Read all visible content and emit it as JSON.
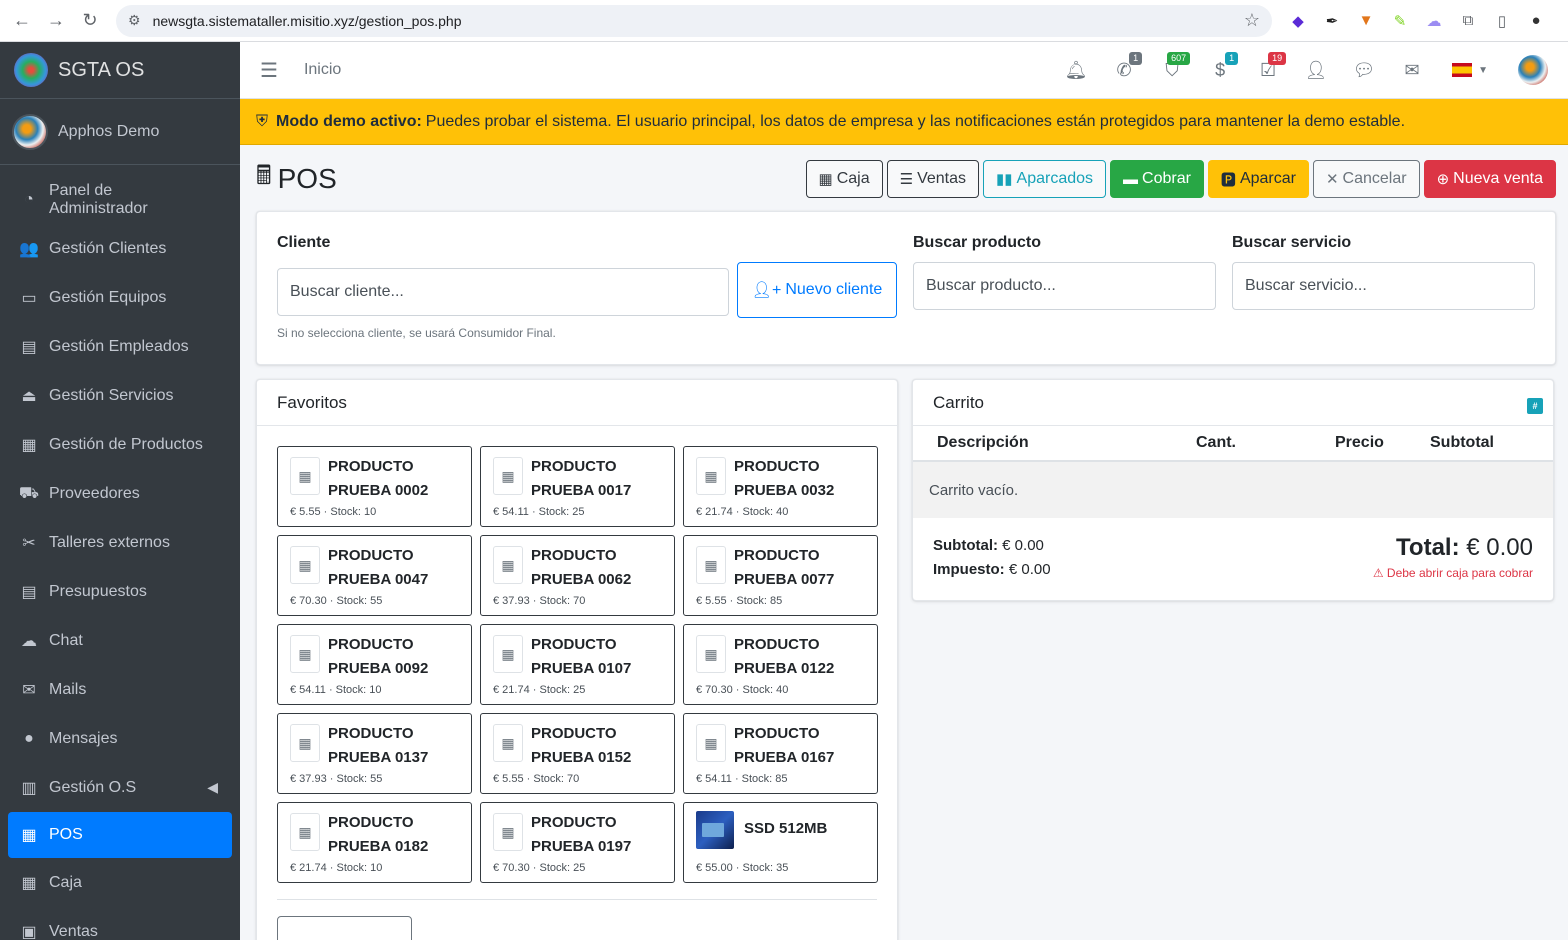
{
  "browser": {
    "url": "newsgta.sistemataller.misitio.xyz/gestion_pos.php"
  },
  "brand": {
    "name": "SGTA OS"
  },
  "user": {
    "name": "Apphos Demo"
  },
  "sidebar": {
    "items": [
      {
        "label": "Panel de Administrador",
        "icon": "dashboard-icon",
        "glyph": "◔"
      },
      {
        "label": "Gestión Clientes",
        "icon": "users-icon",
        "glyph": "👥"
      },
      {
        "label": "Gestión Equipos",
        "icon": "laptop-icon",
        "glyph": "💻"
      },
      {
        "label": "Gestión Empleados",
        "icon": "id-card-icon",
        "glyph": "🪪"
      },
      {
        "label": "Gestión Servicios",
        "icon": "concierge-bell-icon",
        "glyph": "🛎"
      },
      {
        "label": "Gestión de Productos",
        "icon": "box-icon",
        "glyph": "📦"
      },
      {
        "label": "Proveedores",
        "icon": "truck-icon",
        "glyph": "🚚"
      },
      {
        "label": "Talleres externos",
        "icon": "tools-icon",
        "glyph": "🛠"
      },
      {
        "label": "Presupuestos",
        "icon": "invoice-icon",
        "glyph": "📄"
      },
      {
        "label": "Chat",
        "icon": "chat-icon",
        "glyph": "💬"
      },
      {
        "label": "Mails",
        "icon": "envelope-icon",
        "glyph": "✉"
      },
      {
        "label": "Mensajes",
        "icon": "comment-dots-icon",
        "glyph": "🗨"
      },
      {
        "label": "Gestión O.S",
        "icon": "clipboard-icon",
        "glyph": "📋"
      },
      {
        "label": "POS",
        "icon": "cash-register-icon",
        "glyph": "🖩"
      },
      {
        "label": "Caja",
        "icon": "cash-register-icon",
        "glyph": "🖩"
      },
      {
        "label": "Ventas",
        "icon": "cart-icon",
        "glyph": "🛒"
      }
    ]
  },
  "topnav": {
    "home": "Inicio",
    "badges": {
      "phone": "1",
      "tags": "607",
      "money": "1",
      "tasks": "19"
    }
  },
  "demo": {
    "bold": "Modo demo activo:",
    "text": "Puedes probar el sistema. El usuario principal, los datos de empresa y las notificaciones están protegidos para mantener la demo estable."
  },
  "page": {
    "title": "POS"
  },
  "actions": {
    "caja": "Caja",
    "ventas": "Ventas",
    "aparcados": "Aparcados",
    "cobrar": "Cobrar",
    "aparcar": "Aparcar",
    "cancelar": "Cancelar",
    "nueva_venta": "Nueva venta"
  },
  "search": {
    "cliente_label": "Cliente",
    "cliente_placeholder": "Buscar cliente...",
    "nuevo_cliente": "Nuevo cliente",
    "hint": "Si no selecciona cliente, se usará Consumidor Final.",
    "producto_label": "Buscar producto",
    "producto_placeholder": "Buscar producto...",
    "servicio_label": "Buscar servicio",
    "servicio_placeholder": "Buscar servicio..."
  },
  "favoritos": {
    "title": "Favoritos",
    "products": [
      {
        "name1": "PRODUCTO",
        "name2": "PRUEBA 0002",
        "meta": "€ 5.55 · Stock: 10"
      },
      {
        "name1": "PRODUCTO",
        "name2": "PRUEBA 0017",
        "meta": "€ 54.11 · Stock: 25"
      },
      {
        "name1": "PRODUCTO",
        "name2": "PRUEBA 0032",
        "meta": "€ 21.74 · Stock: 40"
      },
      {
        "name1": "PRODUCTO",
        "name2": "PRUEBA 0047",
        "meta": "€ 70.30 · Stock: 55"
      },
      {
        "name1": "PRODUCTO",
        "name2": "PRUEBA 0062",
        "meta": "€ 37.93 · Stock: 70"
      },
      {
        "name1": "PRODUCTO",
        "name2": "PRUEBA 0077",
        "meta": "€ 5.55 · Stock: 85"
      },
      {
        "name1": "PRODUCTO",
        "name2": "PRUEBA 0092",
        "meta": "€ 54.11 · Stock: 10"
      },
      {
        "name1": "PRODUCTO",
        "name2": "PRUEBA 0107",
        "meta": "€ 21.74 · Stock: 25"
      },
      {
        "name1": "PRODUCTO",
        "name2": "PRUEBA 0122",
        "meta": "€ 70.30 · Stock: 40"
      },
      {
        "name1": "PRODUCTO",
        "name2": "PRUEBA 0137",
        "meta": "€ 37.93 · Stock: 55"
      },
      {
        "name1": "PRODUCTO",
        "name2": "PRUEBA 0152",
        "meta": "€ 5.55 · Stock: 70"
      },
      {
        "name1": "PRODUCTO",
        "name2": "PRUEBA 0167",
        "meta": "€ 54.11 · Stock: 85"
      },
      {
        "name1": "PRODUCTO",
        "name2": "PRUEBA 0182",
        "meta": "€ 21.74 · Stock: 10"
      },
      {
        "name1": "PRODUCTO",
        "name2": "PRUEBA 0197",
        "meta": "€ 70.30 · Stock: 25"
      },
      {
        "name1": "SSD 512MB",
        "name2": "",
        "meta": "€ 55.00 · Stock: 35",
        "image": true
      }
    ]
  },
  "cart": {
    "title": "Carrito",
    "hash": "#",
    "columns": [
      "Descripción",
      "Cant.",
      "Precio",
      "Subtotal"
    ],
    "empty": "Carrito vacío.",
    "subtotal_label": "Subtotal:",
    "subtotal_value": "€ 0.00",
    "tax_label": "Impuesto:",
    "tax_value": "€ 0.00",
    "total_label": "Total:",
    "total_value": "€ 0.00",
    "warning": "Debe abrir caja para cobrar"
  }
}
